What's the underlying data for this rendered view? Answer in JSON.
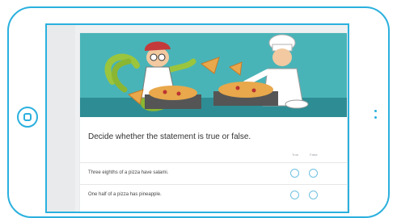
{
  "form": {
    "question": "Decide whether the statement is true or false.",
    "columns": [
      "True",
      "False"
    ],
    "rows": [
      {
        "label": "Three eighths of a pizza have salami."
      },
      {
        "label": "One half of a pizza has pineapple."
      }
    ]
  },
  "colors": {
    "device_outline": "#2ab0de",
    "illustration_background": "#49b4b8",
    "radio_border": "#6fc0e0"
  }
}
